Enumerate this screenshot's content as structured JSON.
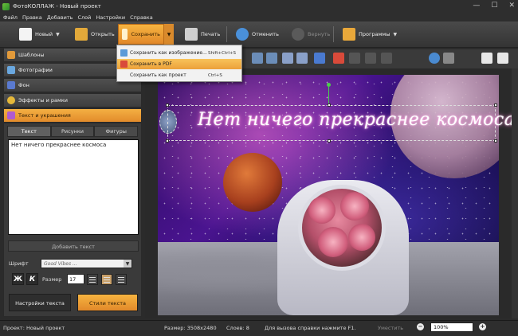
{
  "window": {
    "title": "ФотоКОЛЛАЖ - Новый проект"
  },
  "menu": [
    "Файл",
    "Правка",
    "Добавить",
    "Слой",
    "Настройки",
    "Справка"
  ],
  "toolbar": {
    "new_label": "Новый",
    "open_label": "Открыть",
    "save_label": "Сохранить",
    "print_label": "Печать",
    "undo_label": "Отменить",
    "redo_label": "Вернуть",
    "programs_label": "Программы"
  },
  "save_menu": [
    {
      "label": "Сохранить как изображение...",
      "shortcut": "Shift+Ctrl+S",
      "icon": "image-icon"
    },
    {
      "label": "Сохранить в PDF",
      "shortcut": "",
      "icon": "pdf-icon"
    },
    {
      "label": "Сохранить как проект",
      "shortcut": "Ctrl+S",
      "icon": ""
    }
  ],
  "left_tabs": [
    "Шаблоны",
    "Фотографии",
    "Фон",
    "Эффекты и рамки",
    "Текст и украшения"
  ],
  "text_panel": {
    "subtabs": [
      "Текст",
      "Рисунки",
      "Фигуры"
    ],
    "text_value": "Нет ничего прекраснее космоса",
    "add_text_label": "Добавить текст",
    "font_label": "Шрифт",
    "font_value": "Good Vibes ...",
    "bold_label": "Ж",
    "italic_label": "К",
    "size_label": "Размер",
    "size_value": "17",
    "settings_label": "Настройки текста",
    "styles_label": "Стили текста"
  },
  "canvas": {
    "caption": "Нет ничего прекраснее космоса"
  },
  "status": {
    "project": "Проект: Новый проект",
    "size": "Размер: 3508x2480",
    "layers": "Слоев: 8",
    "help": "Для вызова справки нажмите F1.",
    "fit": "Уместить",
    "zoom": "100%"
  },
  "colors": {
    "accent": "#f0a53a",
    "toolbar": "#3d3d3d",
    "panel": "#3a3a3a"
  }
}
